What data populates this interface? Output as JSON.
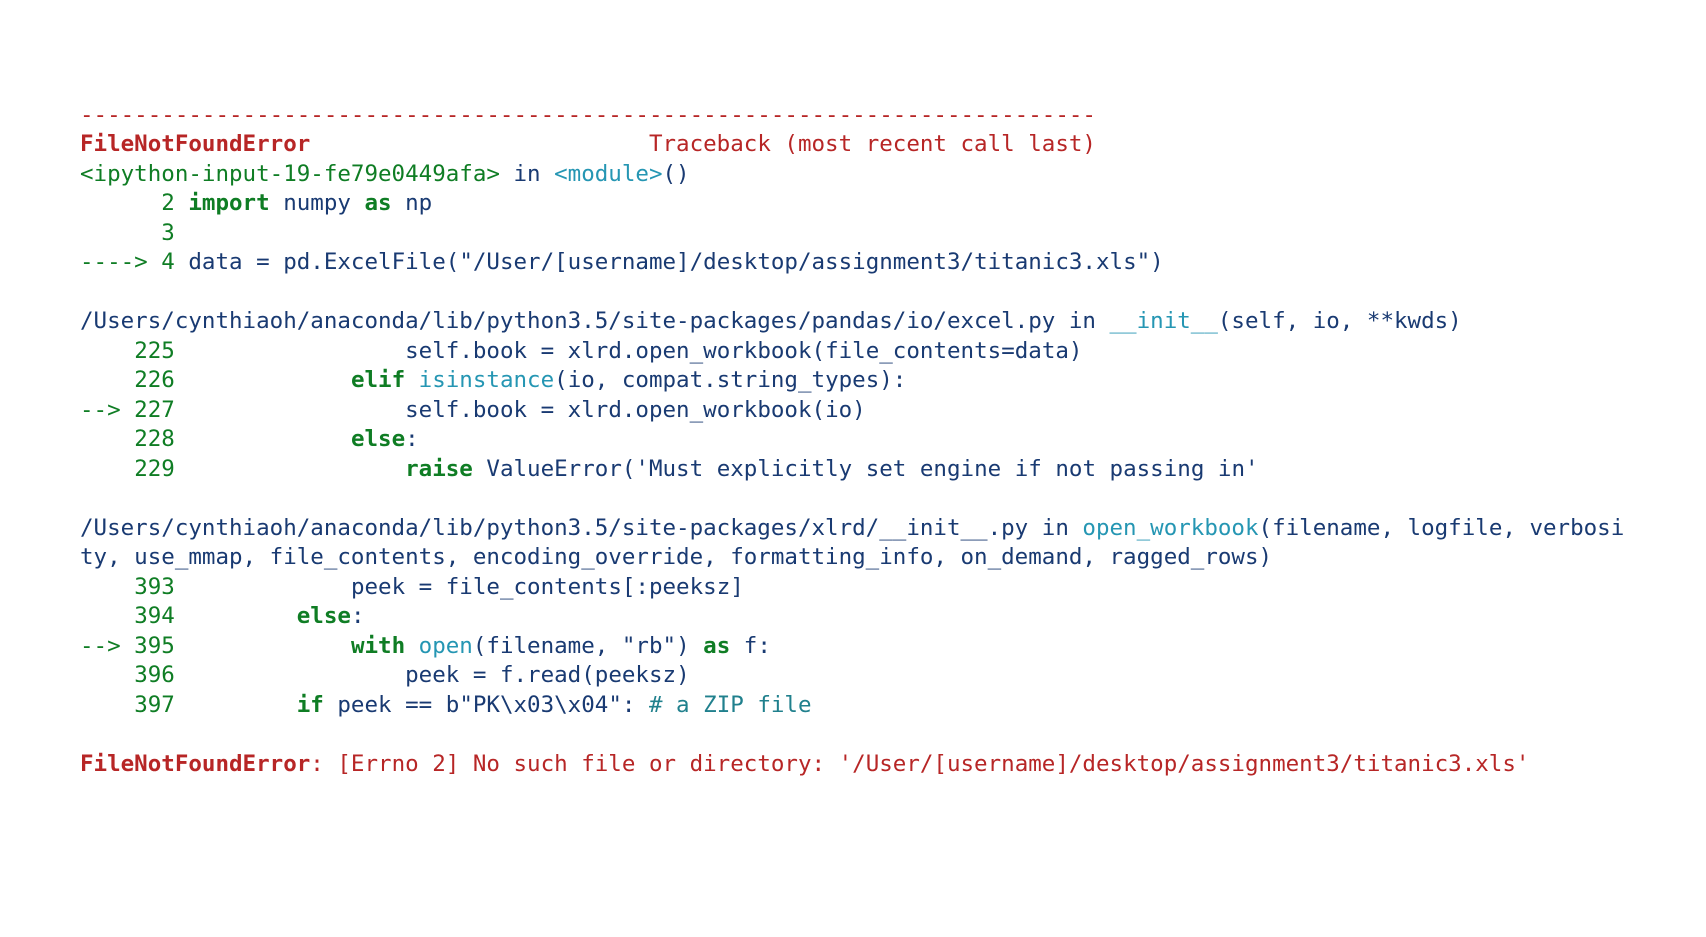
{
  "divider": "---------------------------------------------------------------------------",
  "header_error": "FileNotFoundError",
  "header_spacer": "                         ",
  "header_tb": "Traceback (most recent call last)",
  "f0_loc": "<ipython-input-19-fe79e0449afa>",
  "f0_in": " in ",
  "f0_func": "<module>",
  "f0_sig": "()",
  "f0_l1_num": "      2 ",
  "f0_l1_import": "import",
  "f0_l1_sp1": " ",
  "f0_l1_numpy": "numpy",
  "f0_l1_sp2": " ",
  "f0_l1_as": "as",
  "f0_l1_sp3": " ",
  "f0_l1_np": "np",
  "f0_l2_num": "      3 ",
  "f0_l3_arrow": "----> 4 ",
  "f0_l3_txt1": "data ",
  "f0_l3_eq": "=",
  "f0_l3_txt2": " pd",
  "f0_l3_dot1": ".",
  "f0_l3_excel": "ExcelFile",
  "f0_l3_op": "(",
  "f0_l3_str": "\"/User/[username]/desktop/assignment3/titanic3.xls\"",
  "f0_l3_cp": ")",
  "blank": "",
  "f1_path": "/Users/cynthiaoh/anaconda/lib/python3.5/site-packages/pandas/io/excel.py",
  "f1_in": " in ",
  "f1_func": "__init__",
  "f1_sig": "(self, io, **kwds)",
  "f1_l225_num": "    225 ",
  "f1_l225_indent": "                ",
  "f1_l225_a": "self",
  "f1_l225_b": ".",
  "f1_l225_c": "book ",
  "f1_l225_d": "=",
  "f1_l225_e": " xlrd",
  "f1_l225_f": ".",
  "f1_l225_g": "open_workbook",
  "f1_l225_h": "(",
  "f1_l225_i": "file_contents",
  "f1_l225_j": "=",
  "f1_l225_k": "data",
  "f1_l225_l": ")",
  "f1_l226_num": "    226 ",
  "f1_l226_indent": "            ",
  "f1_l226_elif": "elif",
  "f1_l226_sp": " ",
  "f1_l226_isinst": "isinstance",
  "f1_l226_a": "(",
  "f1_l226_b": "io",
  "f1_l226_c": ",",
  "f1_l226_d": " compat",
  "f1_l226_e": ".",
  "f1_l226_f": "string_types",
  "f1_l226_g": "):",
  "f1_l227_arrow": "--> 227 ",
  "f1_l227_indent": "                ",
  "f1_l227_a": "self",
  "f1_l227_b": ".",
  "f1_l227_c": "book ",
  "f1_l227_d": "=",
  "f1_l227_e": " xlrd",
  "f1_l227_f": ".",
  "f1_l227_g": "open_workbook",
  "f1_l227_h": "(",
  "f1_l227_i": "io",
  "f1_l227_j": ")",
  "f1_l228_num": "    228 ",
  "f1_l228_indent": "            ",
  "f1_l228_else": "else",
  "f1_l228_colon": ":",
  "f1_l229_num": "    229 ",
  "f1_l229_indent": "                ",
  "f1_l229_raise": "raise",
  "f1_l229_sp": " ",
  "f1_l229_ve": "ValueError",
  "f1_l229_op": "(",
  "f1_l229_str": "'Must explicitly set engine if not passing in'",
  "f2_path": "/Users/cynthiaoh/anaconda/lib/python3.5/site-packages/xlrd/__init__.py",
  "f2_in": " in ",
  "f2_func": "open_workbook",
  "f2_sig": "(filename, logfile, verbosity, use_mmap, file_contents, encoding_override, formatting_info, on_demand, ragged_rows)",
  "f2_l393_num": "    393 ",
  "f2_l393_indent": "            ",
  "f2_l393_a": "peek ",
  "f2_l393_b": "=",
  "f2_l393_c": " file_contents",
  "f2_l393_d": "[:",
  "f2_l393_e": "peeksz",
  "f2_l393_f": "]",
  "f2_l394_num": "    394 ",
  "f2_l394_indent": "        ",
  "f2_l394_else": "else",
  "f2_l394_colon": ":",
  "f2_l395_arrow": "--> 395 ",
  "f2_l395_indent": "            ",
  "f2_l395_with": "with",
  "f2_l395_sp1": " ",
  "f2_l395_open": "open",
  "f2_l395_a": "(",
  "f2_l395_b": "filename",
  "f2_l395_c": ",",
  "f2_l395_d": " ",
  "f2_l395_e": "\"rb\"",
  "f2_l395_f": ")",
  "f2_l395_sp2": " ",
  "f2_l395_as": "as",
  "f2_l395_g": " f",
  "f2_l395_h": ":",
  "f2_l396_num": "    396 ",
  "f2_l396_indent": "                ",
  "f2_l396_a": "peek ",
  "f2_l396_b": "=",
  "f2_l396_c": " f",
  "f2_l396_d": ".",
  "f2_l396_e": "read",
  "f2_l396_f": "(",
  "f2_l396_g": "peeksz",
  "f2_l396_h": ")",
  "f2_l397_num": "    397 ",
  "f2_l397_indent": "        ",
  "f2_l397_if": "if",
  "f2_l397_a": " peek ",
  "f2_l397_b": "==",
  "f2_l397_c": " b",
  "f2_l397_d": "\"PK\\x03\\x04\"",
  "f2_l397_e": ":",
  "f2_l397_f": " ",
  "f2_l397_g": "# a ZIP file",
  "final_err": "FileNotFoundError",
  "final_msg": ": [Errno 2] No such file or directory: '/User/[username]/desktop/assignment3/titanic3.xls'"
}
